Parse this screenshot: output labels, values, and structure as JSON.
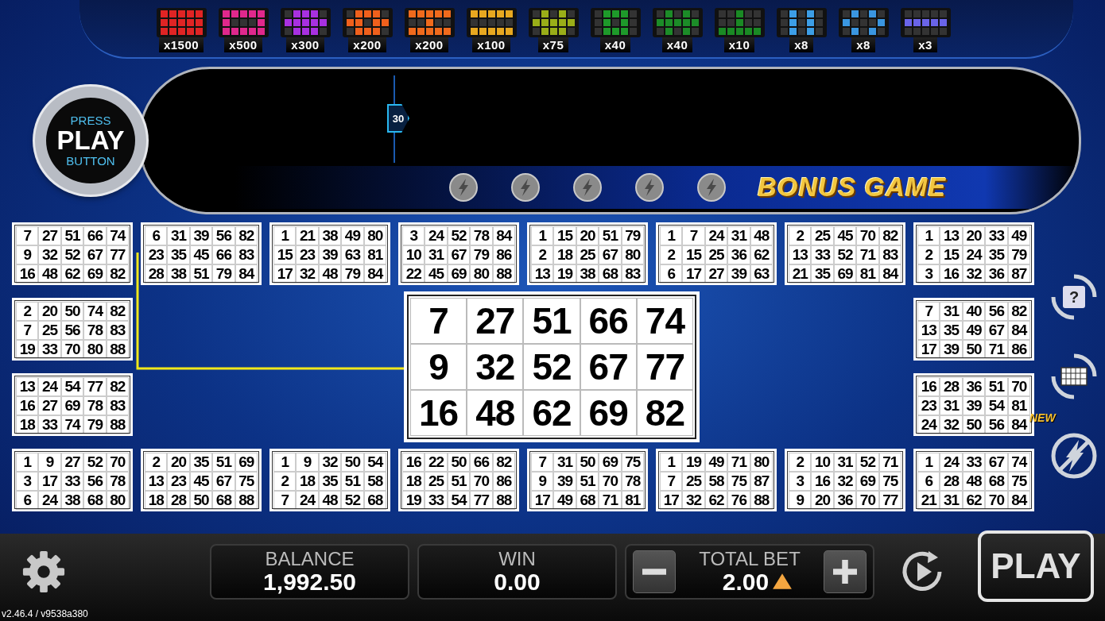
{
  "paytable": [
    {
      "multiplier": "x1500",
      "color": "#e02424",
      "cells": [
        [
          true,
          true,
          true,
          true,
          true
        ],
        [
          true,
          true,
          true,
          true,
          true
        ],
        [
          true,
          true,
          true,
          true,
          true
        ]
      ]
    },
    {
      "multiplier": "x500",
      "color": "#e0288c",
      "cells": [
        [
          true,
          true,
          true,
          true,
          true
        ],
        [
          true,
          false,
          false,
          false,
          true
        ],
        [
          true,
          true,
          true,
          true,
          true
        ]
      ]
    },
    {
      "multiplier": "x300",
      "color": "#a830e0",
      "cells": [
        [
          false,
          true,
          true,
          true,
          false
        ],
        [
          true,
          true,
          true,
          true,
          true
        ],
        [
          false,
          true,
          true,
          true,
          false
        ]
      ]
    },
    {
      "multiplier": "x200",
      "color": "#f0601c",
      "cells": [
        [
          false,
          true,
          true,
          true,
          false
        ],
        [
          true,
          true,
          false,
          true,
          true
        ],
        [
          false,
          true,
          true,
          true,
          false
        ]
      ]
    },
    {
      "multiplier": "x200",
      "color": "#f06a1c",
      "cells": [
        [
          true,
          true,
          true,
          true,
          true
        ],
        [
          false,
          false,
          true,
          false,
          false
        ],
        [
          true,
          true,
          true,
          true,
          true
        ]
      ]
    },
    {
      "multiplier": "x100",
      "color": "#e8a820",
      "cells": [
        [
          true,
          true,
          true,
          true,
          true
        ],
        [
          false,
          false,
          false,
          false,
          false
        ],
        [
          true,
          true,
          true,
          true,
          true
        ]
      ]
    },
    {
      "multiplier": "x75",
      "color": "#9aae18",
      "cells": [
        [
          false,
          true,
          false,
          true,
          false
        ],
        [
          true,
          true,
          true,
          true,
          true
        ],
        [
          false,
          true,
          true,
          true,
          false
        ]
      ]
    },
    {
      "multiplier": "x40",
      "color": "#1e9a2a",
      "cells": [
        [
          false,
          true,
          true,
          true,
          false
        ],
        [
          false,
          true,
          false,
          true,
          false
        ],
        [
          false,
          true,
          true,
          true,
          false
        ]
      ]
    },
    {
      "multiplier": "x40",
      "color": "#1c8c28",
      "cells": [
        [
          false,
          true,
          false,
          true,
          false
        ],
        [
          true,
          true,
          true,
          true,
          true
        ],
        [
          false,
          true,
          false,
          true,
          false
        ]
      ]
    },
    {
      "multiplier": "x10",
      "color": "#1a8a24",
      "cells": [
        [
          false,
          false,
          true,
          false,
          false
        ],
        [
          false,
          false,
          true,
          false,
          false
        ],
        [
          true,
          true,
          true,
          true,
          true
        ]
      ]
    },
    {
      "multiplier": "x8",
      "color": "#3c9ee6",
      "cells": [
        [
          false,
          true,
          false,
          true,
          false
        ],
        [
          false,
          true,
          false,
          true,
          false
        ],
        [
          false,
          true,
          false,
          true,
          false
        ]
      ]
    },
    {
      "multiplier": "x8",
      "color": "#3a96e0",
      "cells": [
        [
          false,
          true,
          false,
          true,
          false
        ],
        [
          true,
          false,
          false,
          false,
          true
        ],
        [
          false,
          true,
          false,
          true,
          false
        ]
      ]
    },
    {
      "multiplier": "x3",
      "color": "#6a64e8",
      "cells": [
        [
          false,
          false,
          false,
          false,
          false
        ],
        [
          true,
          true,
          true,
          true,
          true
        ],
        [
          false,
          false,
          false,
          false,
          false
        ]
      ]
    }
  ],
  "press_play": {
    "top": "PRESS",
    "main": "PLAY",
    "bottom": "BUTTON"
  },
  "countdown": {
    "label": "30"
  },
  "bonus_coins": [
    {
      "lit": false
    },
    {
      "lit": false
    },
    {
      "lit": false
    },
    {
      "lit": false
    },
    {
      "lit": false
    }
  ],
  "bonus_title": "BONUS GAME",
  "cards_top": [
    {
      "rows": [
        [
          "7",
          "27",
          "51",
          "66",
          "74"
        ],
        [
          "9",
          "32",
          "52",
          "67",
          "77"
        ],
        [
          "16",
          "48",
          "62",
          "69",
          "82"
        ]
      ]
    },
    {
      "rows": [
        [
          "6",
          "31",
          "39",
          "56",
          "82"
        ],
        [
          "23",
          "35",
          "45",
          "66",
          "83"
        ],
        [
          "28",
          "38",
          "51",
          "79",
          "84"
        ]
      ]
    },
    {
      "rows": [
        [
          "1",
          "21",
          "38",
          "49",
          "80"
        ],
        [
          "15",
          "23",
          "39",
          "63",
          "81"
        ],
        [
          "17",
          "32",
          "48",
          "79",
          "84"
        ]
      ]
    },
    {
      "rows": [
        [
          "3",
          "24",
          "52",
          "78",
          "84"
        ],
        [
          "10",
          "31",
          "67",
          "79",
          "86"
        ],
        [
          "22",
          "45",
          "69",
          "80",
          "88"
        ]
      ]
    },
    {
      "rows": [
        [
          "1",
          "15",
          "20",
          "51",
          "79"
        ],
        [
          "2",
          "18",
          "25",
          "67",
          "80"
        ],
        [
          "13",
          "19",
          "38",
          "68",
          "83"
        ]
      ]
    },
    {
      "rows": [
        [
          "1",
          "7",
          "24",
          "31",
          "48"
        ],
        [
          "2",
          "15",
          "25",
          "36",
          "62"
        ],
        [
          "6",
          "17",
          "27",
          "39",
          "63"
        ]
      ]
    },
    {
      "rows": [
        [
          "2",
          "25",
          "45",
          "70",
          "82"
        ],
        [
          "13",
          "33",
          "52",
          "71",
          "83"
        ],
        [
          "21",
          "35",
          "69",
          "81",
          "84"
        ]
      ]
    },
    {
      "rows": [
        [
          "1",
          "13",
          "20",
          "33",
          "49"
        ],
        [
          "2",
          "15",
          "24",
          "35",
          "79"
        ],
        [
          "3",
          "16",
          "32",
          "36",
          "87"
        ]
      ]
    }
  ],
  "cards_left": [
    {
      "rows": [
        [
          "2",
          "20",
          "50",
          "74",
          "82"
        ],
        [
          "7",
          "25",
          "56",
          "78",
          "83"
        ],
        [
          "19",
          "33",
          "70",
          "80",
          "88"
        ]
      ]
    },
    {
      "rows": [
        [
          "13",
          "24",
          "54",
          "77",
          "82"
        ],
        [
          "16",
          "27",
          "69",
          "78",
          "83"
        ],
        [
          "18",
          "33",
          "74",
          "79",
          "88"
        ]
      ]
    }
  ],
  "featured_card": {
    "rows": [
      [
        "7",
        "27",
        "51",
        "66",
        "74"
      ],
      [
        "9",
        "32",
        "52",
        "67",
        "77"
      ],
      [
        "16",
        "48",
        "62",
        "69",
        "82"
      ]
    ]
  },
  "cards_right": [
    {
      "rows": [
        [
          "7",
          "31",
          "40",
          "56",
          "82"
        ],
        [
          "13",
          "35",
          "49",
          "67",
          "84"
        ],
        [
          "17",
          "39",
          "50",
          "71",
          "86"
        ]
      ]
    },
    {
      "rows": [
        [
          "16",
          "28",
          "36",
          "51",
          "70"
        ],
        [
          "23",
          "31",
          "39",
          "54",
          "81"
        ],
        [
          "24",
          "32",
          "50",
          "56",
          "84"
        ]
      ]
    }
  ],
  "cards_bottom": [
    {
      "rows": [
        [
          "1",
          "9",
          "27",
          "52",
          "70"
        ],
        [
          "3",
          "17",
          "33",
          "56",
          "78"
        ],
        [
          "6",
          "24",
          "38",
          "68",
          "80"
        ]
      ]
    },
    {
      "rows": [
        [
          "2",
          "20",
          "35",
          "51",
          "69"
        ],
        [
          "13",
          "23",
          "45",
          "67",
          "75"
        ],
        [
          "18",
          "28",
          "50",
          "68",
          "88"
        ]
      ]
    },
    {
      "rows": [
        [
          "1",
          "9",
          "32",
          "50",
          "54"
        ],
        [
          "2",
          "18",
          "35",
          "51",
          "58"
        ],
        [
          "7",
          "24",
          "48",
          "52",
          "68"
        ]
      ]
    },
    {
      "rows": [
        [
          "16",
          "22",
          "50",
          "66",
          "82"
        ],
        [
          "18",
          "25",
          "51",
          "70",
          "86"
        ],
        [
          "19",
          "33",
          "54",
          "77",
          "88"
        ]
      ]
    },
    {
      "rows": [
        [
          "7",
          "31",
          "50",
          "69",
          "75"
        ],
        [
          "9",
          "39",
          "51",
          "70",
          "78"
        ],
        [
          "17",
          "49",
          "68",
          "71",
          "81"
        ]
      ]
    },
    {
      "rows": [
        [
          "1",
          "19",
          "49",
          "71",
          "80"
        ],
        [
          "7",
          "25",
          "58",
          "75",
          "87"
        ],
        [
          "17",
          "32",
          "62",
          "76",
          "88"
        ]
      ]
    },
    {
      "rows": [
        [
          "2",
          "10",
          "31",
          "52",
          "71"
        ],
        [
          "3",
          "16",
          "32",
          "69",
          "75"
        ],
        [
          "9",
          "20",
          "36",
          "70",
          "77"
        ]
      ]
    },
    {
      "rows": [
        [
          "1",
          "24",
          "33",
          "67",
          "74"
        ],
        [
          "6",
          "28",
          "48",
          "68",
          "75"
        ],
        [
          "21",
          "31",
          "62",
          "70",
          "84"
        ]
      ]
    }
  ],
  "side_buttons": [
    {
      "kind": "help",
      "glyph": "?"
    },
    {
      "kind": "cards"
    },
    {
      "kind": "turbo",
      "badge": "NEW"
    }
  ],
  "balance": {
    "label": "BALANCE",
    "value": "1,992.50"
  },
  "win": {
    "label": "WIN",
    "value": "0.00"
  },
  "total_bet": {
    "label": "TOTAL BET",
    "value": "2.00"
  },
  "play_button": "PLAY",
  "version": "v2.46.4 / v9538a380"
}
